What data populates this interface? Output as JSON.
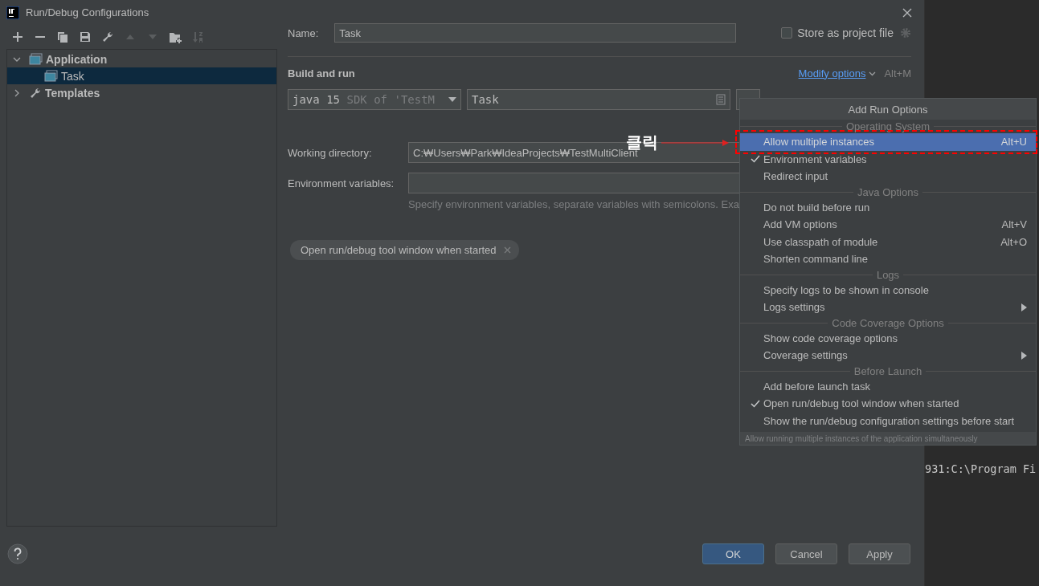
{
  "window": {
    "title": "Run/Debug Configurations"
  },
  "toolbar": [
    {
      "kind": "add",
      "disabled": false
    },
    {
      "kind": "remove",
      "disabled": false
    },
    {
      "kind": "copy",
      "disabled": false
    },
    {
      "kind": "save",
      "disabled": false
    },
    {
      "kind": "wrench",
      "disabled": false
    },
    {
      "kind": "up",
      "disabled": true
    },
    {
      "kind": "down",
      "disabled": true
    },
    {
      "kind": "folder",
      "disabled": false
    },
    {
      "kind": "sort",
      "disabled": true
    }
  ],
  "tree": [
    {
      "label": "Application",
      "kind": "application",
      "expanded": true,
      "selected": false,
      "children": [
        {
          "label": "Task",
          "kind": "config",
          "selected": true
        }
      ]
    },
    {
      "label": "Templates",
      "kind": "templates",
      "expanded": false,
      "selected": false
    }
  ],
  "form": {
    "name_label": "Name:",
    "name_value": "Task",
    "store_label": "Store as project file",
    "store_checked": false,
    "section": "Build and run",
    "modify_link": "Modify options",
    "modify_shortcut": "Alt+M",
    "jre": "java 15",
    "jre_hint": "SDK of 'TestM",
    "main_class": "Task",
    "working_dir_label": "Working directory:",
    "working_dir_value": "C:₩Users₩Park₩IdeaProjects₩TestMultiClient",
    "env_label": "Environment variables:",
    "env_hint": "Specify environment variables, separate variables with semicolons. Exa",
    "chip": "Open run/debug tool window when started"
  },
  "buttons": [
    {
      "label": "OK",
      "default": true
    },
    {
      "label": "Cancel",
      "default": false
    },
    {
      "label": "Apply",
      "default": false
    }
  ],
  "editor": {
    "text": "931:C:\\Program Fi"
  },
  "annotation": {
    "text": "클릭"
  },
  "popup": {
    "title": "Add Run Options",
    "groups": [
      {
        "title": "Operating System",
        "items": [
          {
            "label": "Allow multiple instances",
            "shortcut": "Alt+U",
            "checked": false,
            "selected": true,
            "submenu": false
          },
          {
            "label": "Environment variables",
            "checked": true,
            "selected": false,
            "submenu": false
          },
          {
            "label": "Redirect input",
            "checked": false,
            "selected": false,
            "submenu": false
          }
        ]
      },
      {
        "title": "Java Options",
        "items": [
          {
            "label": "Do not build before run",
            "checked": false,
            "selected": false,
            "submenu": false
          },
          {
            "label": "Add VM options",
            "shortcut": "Alt+V",
            "checked": false,
            "selected": false,
            "submenu": false
          },
          {
            "label": "Use classpath of module",
            "shortcut": "Alt+O",
            "checked": false,
            "selected": false,
            "submenu": false
          },
          {
            "label": "Shorten command line",
            "checked": false,
            "selected": false,
            "submenu": false
          }
        ]
      },
      {
        "title": "Logs",
        "items": [
          {
            "label": "Specify logs to be shown in console",
            "checked": false,
            "selected": false,
            "submenu": false
          },
          {
            "label": "Logs settings",
            "checked": false,
            "selected": false,
            "submenu": true
          }
        ]
      },
      {
        "title": "Code Coverage Options",
        "items": [
          {
            "label": "Show code coverage options",
            "checked": false,
            "selected": false,
            "submenu": false
          },
          {
            "label": "Coverage settings",
            "checked": false,
            "selected": false,
            "submenu": true
          }
        ]
      },
      {
        "title": "Before Launch",
        "items": [
          {
            "label": "Add before launch task",
            "checked": false,
            "selected": false,
            "submenu": false
          },
          {
            "label": "Open run/debug tool window when started",
            "checked": true,
            "selected": false,
            "submenu": false
          },
          {
            "label": "Show the run/debug configuration settings before start",
            "checked": false,
            "selected": false,
            "submenu": false
          }
        ]
      }
    ],
    "footer": "Allow running multiple instances of the application simultaneously"
  }
}
